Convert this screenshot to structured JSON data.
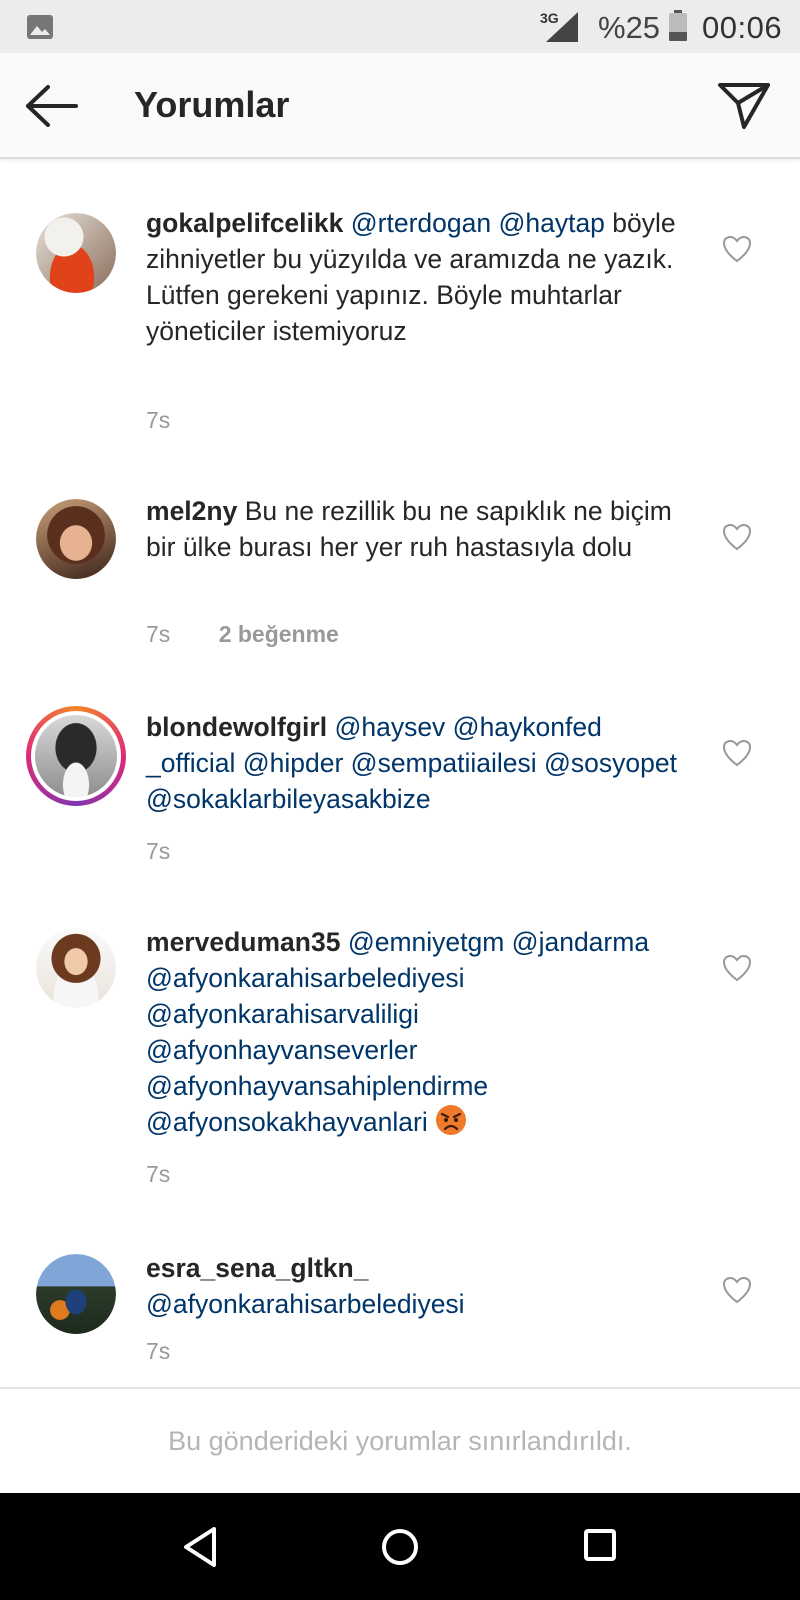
{
  "status_bar": {
    "network": "3G",
    "battery": "%25",
    "time": "00:06"
  },
  "header": {
    "title": "Yorumlar"
  },
  "comments": [
    {
      "username": "gokalpelifcelikk",
      "mentions": "@rterdogan @haytap",
      "text": "böyle zihniyetler bu yüzyılda ve aramızda ne yazık. Lütfen gerekeni yapınız. Böyle muhtarlar yöneticiler istemiyoruz",
      "time": "7s",
      "likes": ""
    },
    {
      "username": "mel2ny",
      "mentions": "",
      "text": "Bu ne rezillik bu ne sapıklık ne biçim bir ülke burası her yer ruh hastasıyla dolu",
      "time": "7s",
      "likes": "2 beğenme"
    },
    {
      "username": "blondewolfgirl",
      "mentions": "@haysev @haykonfed _official @hipder @sempatiiailesi @sosyopet @sokaklarbileyasakbize",
      "text": "",
      "time": "7s",
      "likes": ""
    },
    {
      "username": "merveduman35",
      "mentions": "@emniyetgm @jandarma @afyonkarahisarbelediyesi @afyonkarahisarvaliligi @afyonhayvanseverler @afyonhayvansahiplendirme @afyonsokakhayvanlari",
      "text": "",
      "time": "7s",
      "likes": ""
    },
    {
      "username": "esra_sena_gltkn_",
      "mentions": "@afyonkarahisarbelediyesi",
      "text": "",
      "time": "7s",
      "likes": ""
    }
  ],
  "footer": {
    "message": "Bu gönderideki yorumlar sınırlandırıldı."
  },
  "colors": {
    "mention": "#003569",
    "meta": "#999999",
    "story_ring": "#dd2a7b"
  },
  "icons": [
    "gallery-icon",
    "signal-icon",
    "battery-icon",
    "back-arrow-icon",
    "direct-send-icon",
    "heart-icon",
    "angry-face-emoji",
    "nav-back-icon",
    "nav-home-icon",
    "nav-recents-icon"
  ]
}
